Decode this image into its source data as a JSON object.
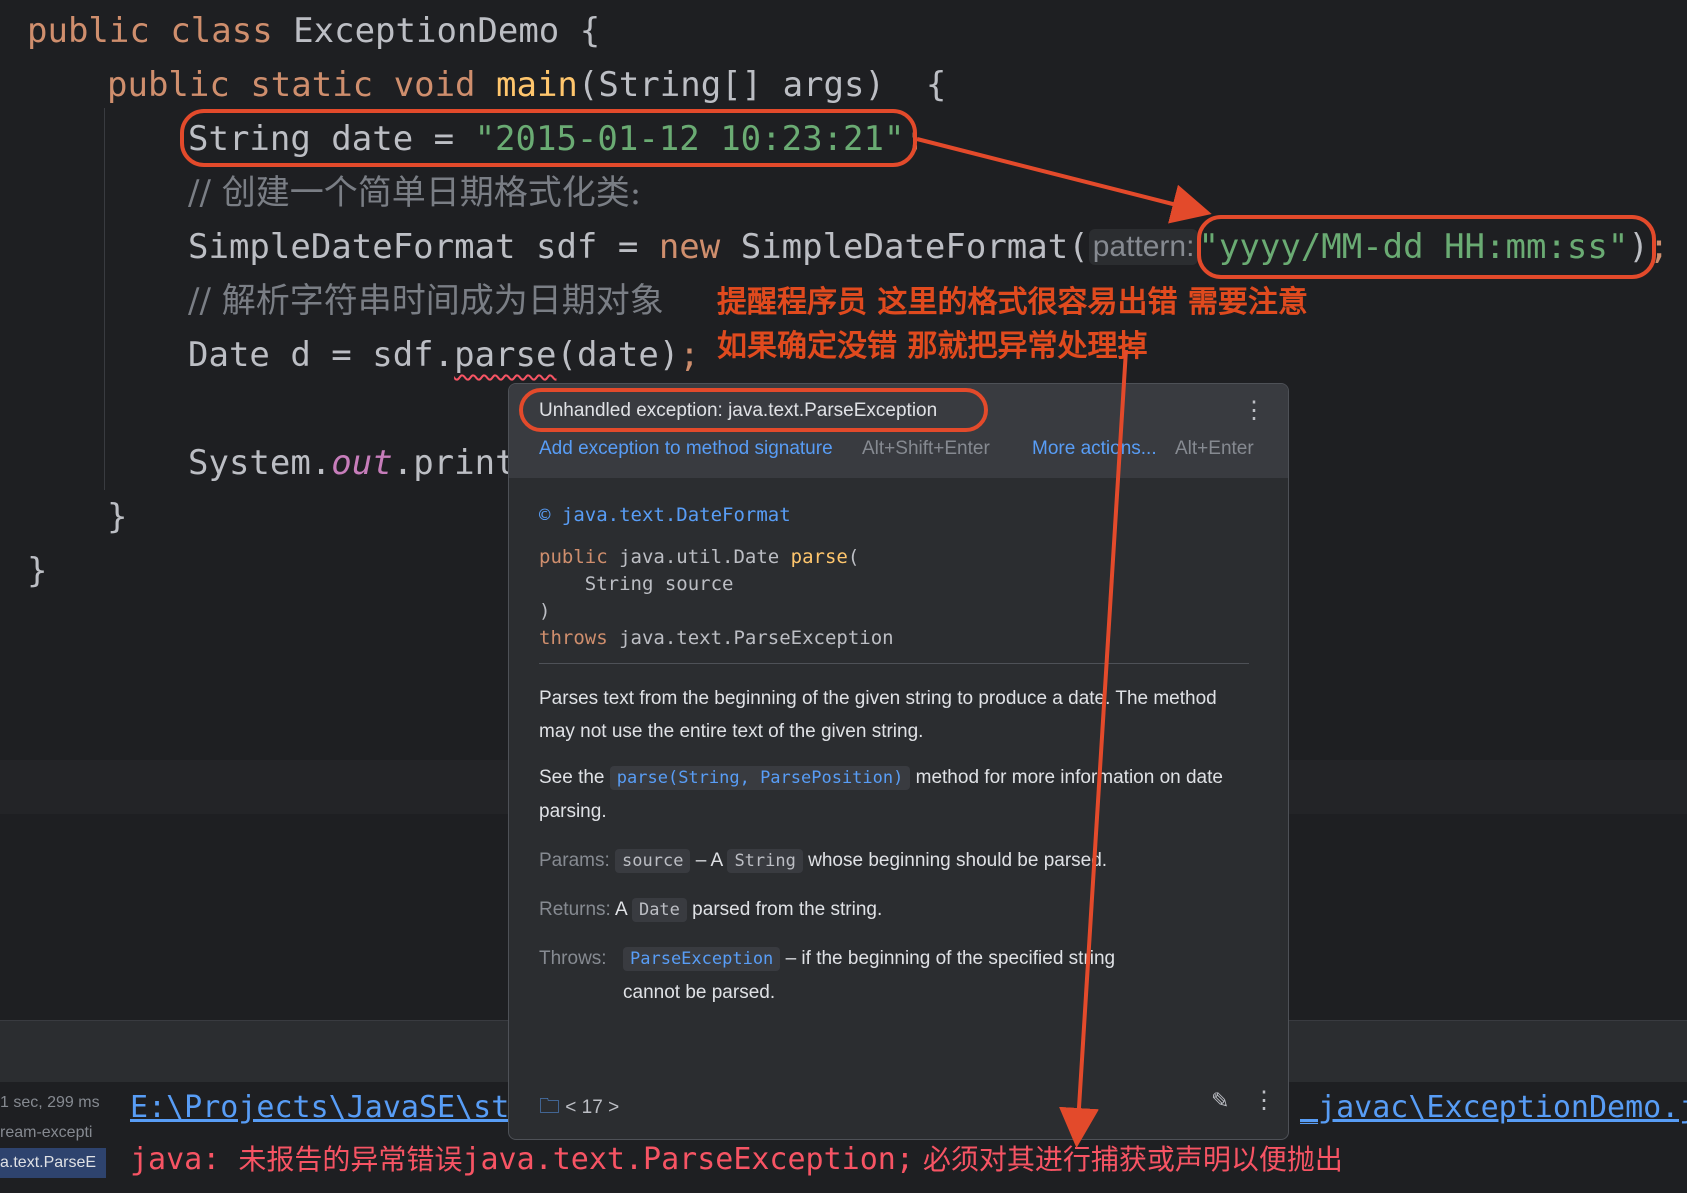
{
  "editor": {
    "line1": {
      "kw1": "public",
      "kw2": "class",
      "name": "ExceptionDemo",
      "brace": "{"
    },
    "line2": {
      "kw1": "public",
      "kw2": "static",
      "kw3": "void",
      "method": "main",
      "params": "(String[] args)",
      "brace": "{"
    },
    "line3": {
      "type": "String date = ",
      "literal": "\"2015-01-12 10:23:21\"",
      "semi": ";"
    },
    "line4": {
      "comment": "// 创建一个简单日期格式化类:"
    },
    "line5": {
      "start": "SimpleDateFormat sdf = ",
      "kw": "new",
      "cls": " SimpleDateFormat(",
      "hint": "pattern:",
      "literal": "\"yyyy/MM-dd HH:mm:ss\"",
      "close": ")",
      "semi": ";"
    },
    "line6": {
      "comment": "// 解析字符串时间成为日期对象"
    },
    "line7": {
      "start": "Date d = sdf.",
      "method": "parse",
      "args": "(date)",
      "semi": ";"
    },
    "line9": {
      "start": "System.",
      "field": "out",
      "rest": ".print"
    },
    "line10": {
      "brace": "}"
    },
    "line11": {
      "brace": "}"
    }
  },
  "annotation": {
    "note_line1": "提醒程序员 这里的格式很容易出错 需要注意",
    "note_line2": "如果确定没错 那就把异常处理掉",
    "color": "#e34a2b"
  },
  "popup": {
    "title": "Unhandled exception: java.text.ParseException",
    "action1": "Add exception to method signature",
    "action1_key": "Alt+Shift+Enter",
    "action2": "More actions...",
    "action2_key": "Alt+Enter",
    "class_icon": "©",
    "class_name": "java.text.DateFormat",
    "sig_kw": "public",
    "sig_type": " java.util.Date ",
    "sig_method": "parse",
    "sig_open": "(",
    "sig_param": "    String source",
    "sig_close": ")",
    "sig_throws": "throws",
    "sig_exc": " java.text.ParseException",
    "desc1": "Parses text from the beginning of the given string to produce a date. The method may not use the entire text of the given string.",
    "see_prefix": "See the ",
    "see_link": "parse(String, ParsePosition)",
    "see_suffix": " method for more information on date parsing.",
    "params_label": "Params:",
    "params_chip": "source",
    "params_mid": " – A ",
    "params_chip2": "String",
    "params_text": " whose beginning should be parsed.",
    "returns_label": "Returns:",
    "returns_pre": " A ",
    "returns_chip": "Date",
    "returns_text": " parsed from the string.",
    "throws_label": "Throws:",
    "throws_chip": "ParseException",
    "throws_text": " – if the beginning of the specified string cannot be parsed.",
    "footer_nav": "< 17 >"
  },
  "console": {
    "side1": "1 sec, 299 ms",
    "side2": "ream-excepti",
    "side3": "a.text.ParseE",
    "path_left": "E:\\Projects\\JavaSE\\strea",
    "path_right": "_javac\\ExceptionDemo.java",
    "err_prefix": "java: ",
    "err_cn1": "未报告的异常错误",
    "err_exc": "java.text.ParseException;",
    "err_cn2": " 必须对其进行捕获或声明以便抛出"
  }
}
